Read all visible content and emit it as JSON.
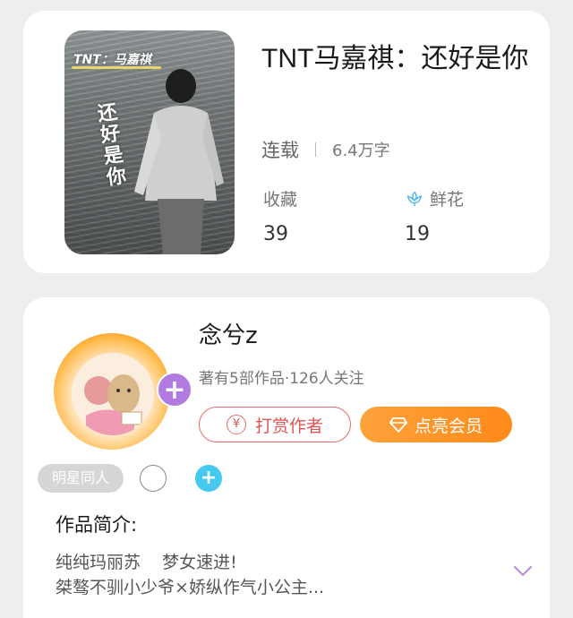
{
  "book": {
    "cover": {
      "tag": "TNT：马嘉祺",
      "vertical_title": "还好是你"
    },
    "title": "TNT马嘉祺：还好是你",
    "status": "连载",
    "word_count": "6.4万字",
    "stats": {
      "favorites_label": "收藏",
      "favorites_value": "39",
      "flowers_label": "鲜花",
      "flowers_value": "19"
    }
  },
  "author": {
    "name": "念兮z",
    "stats_text": "著有5部作品·126人关注",
    "follow_symbol": "+",
    "reward_label": "打赏作者",
    "reward_icon_text": "¥",
    "vip_label": "点亮会员",
    "tags": [
      "明星同人"
    ],
    "add_tag_symbol": "+"
  },
  "intro": {
    "label": "作品简介:",
    "lines": [
      "纯纯玛丽苏    梦女速进!",
      "桀骜不驯小少爷×娇纵作气小公主..."
    ]
  },
  "colors": {
    "accent_orange": "#ff8a1a",
    "reward_red": "#e25353",
    "follow_purple": "#b27be0",
    "add_blue": "#45c9ef",
    "flower_blue": "#4fb8e6"
  }
}
